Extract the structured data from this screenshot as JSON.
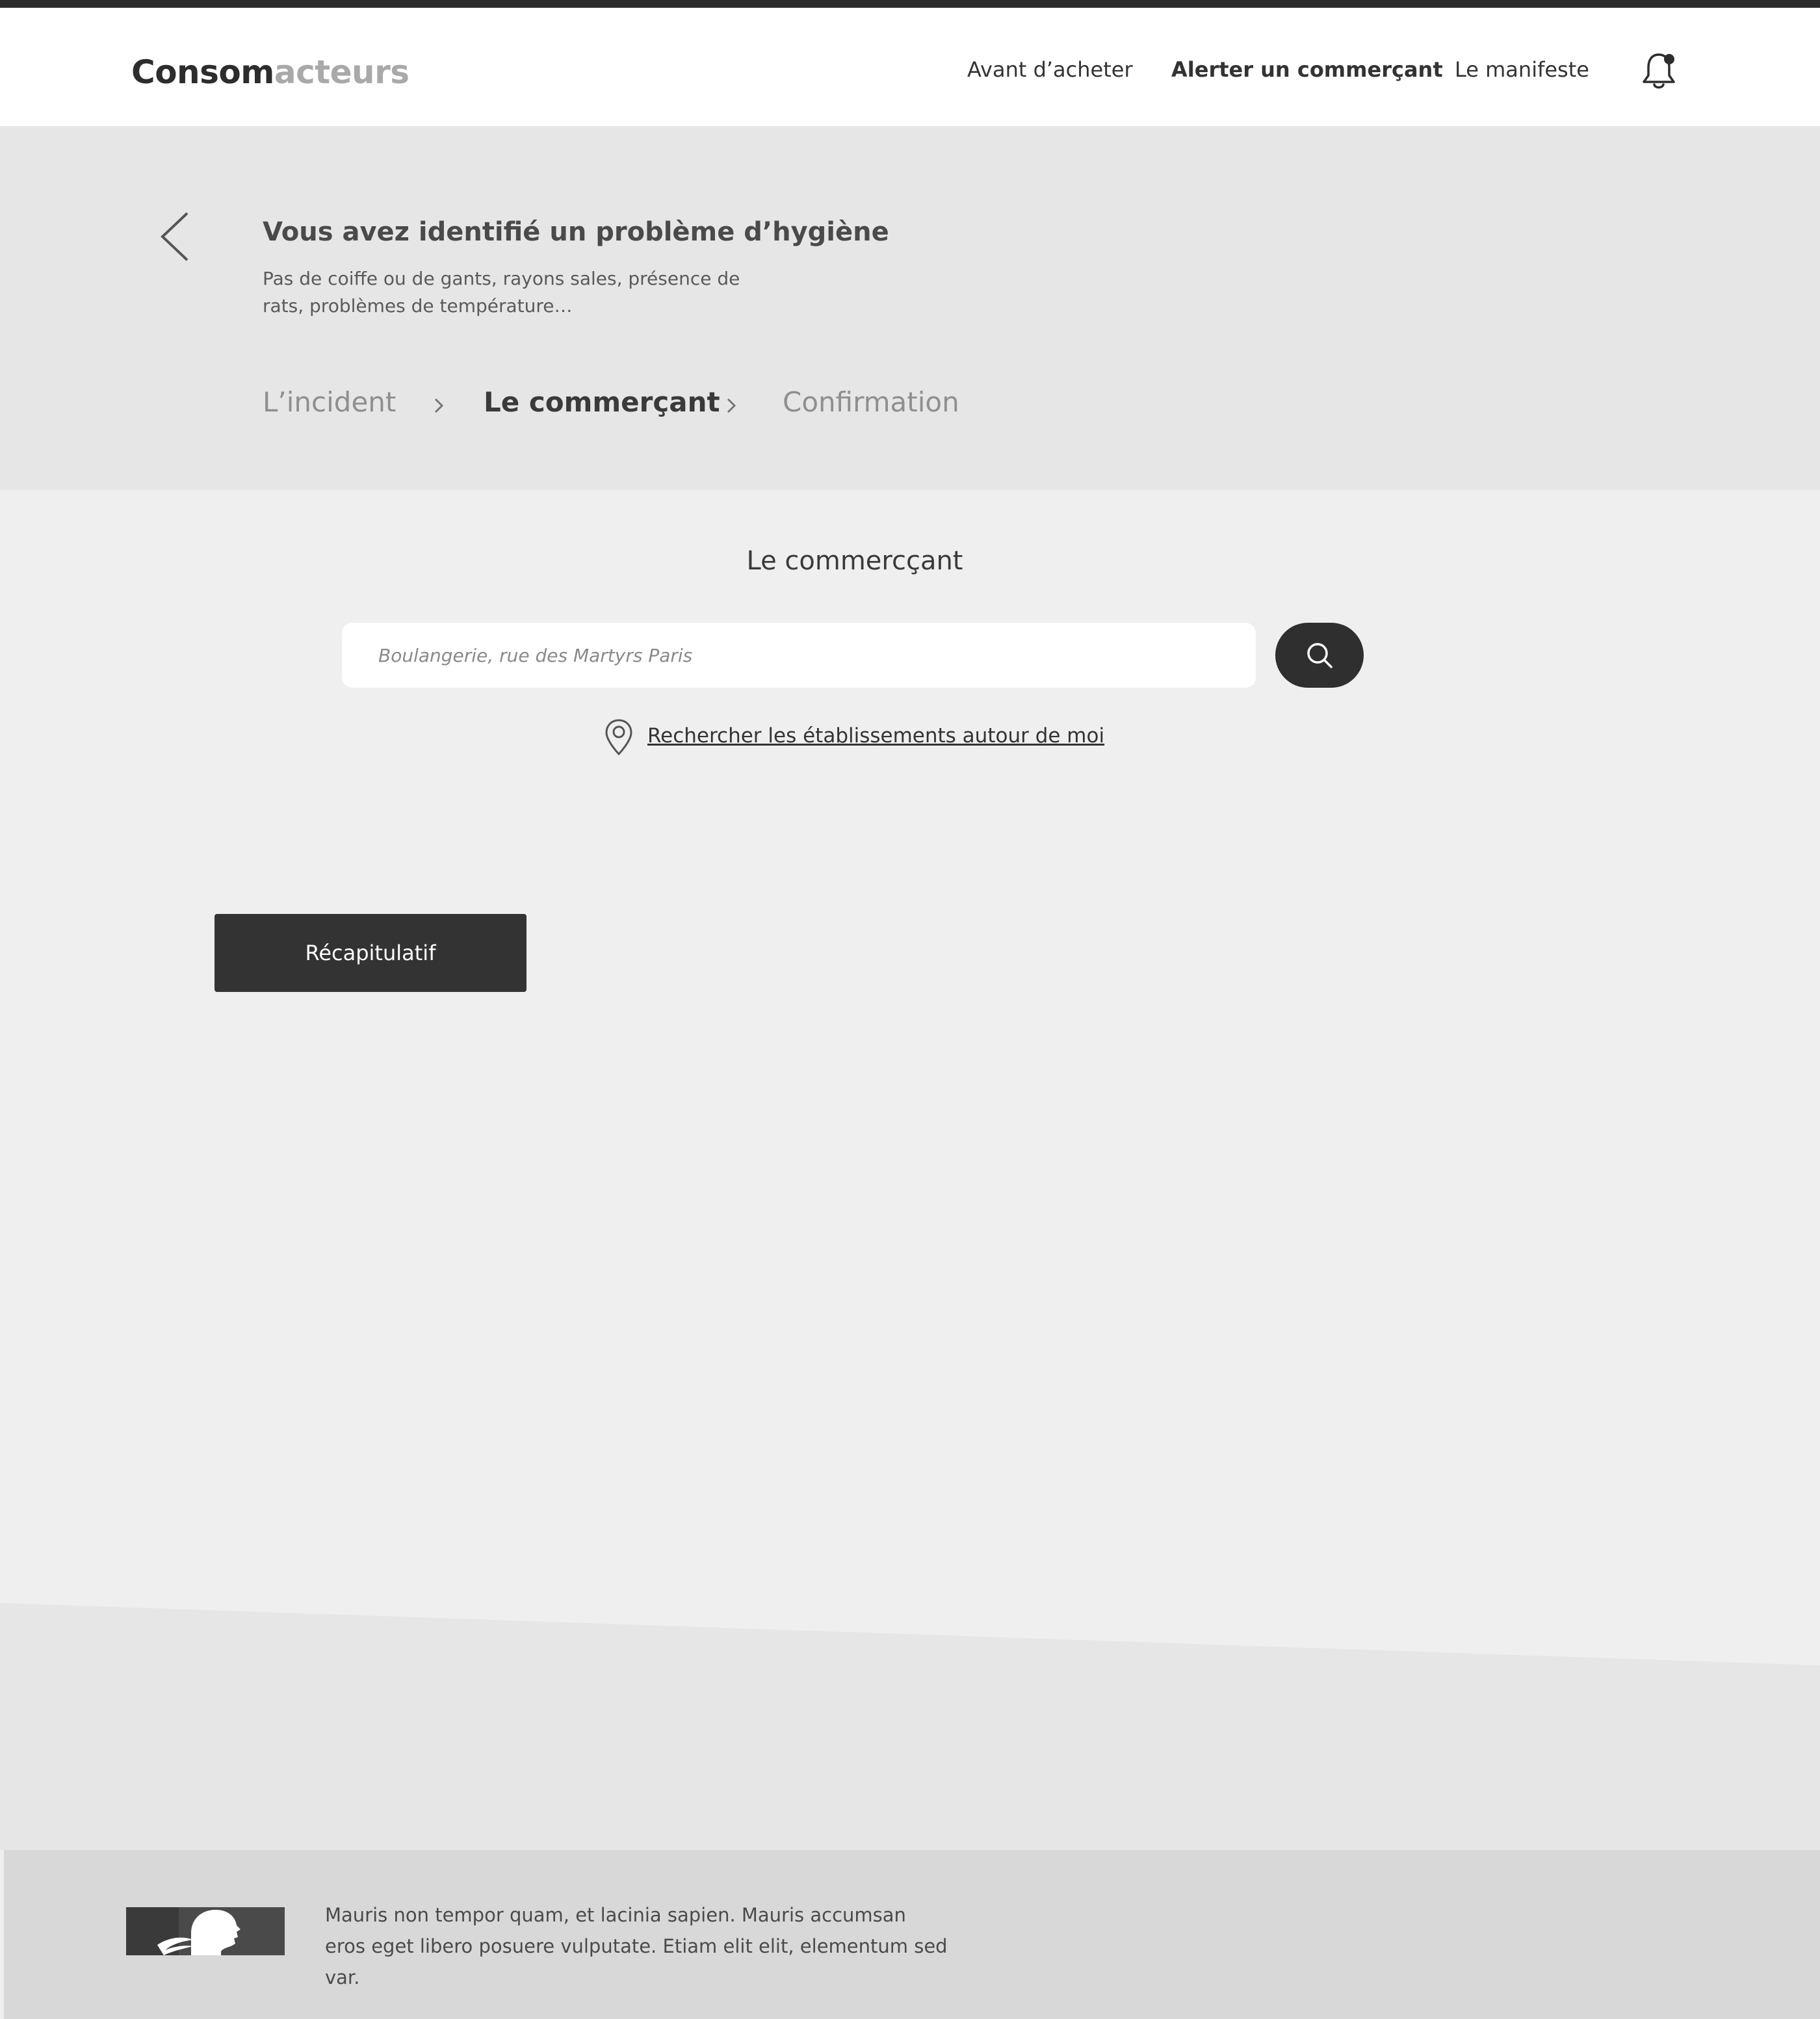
{
  "header": {
    "logo_part1": "Consom",
    "logo_part2": "acteurs",
    "nav": [
      "Avant d’acheter",
      "Alerter un commerçant",
      "Le manifeste"
    ]
  },
  "hero": {
    "title": "Vous avez identifié un problème d’hygiène",
    "subtitle": "Pas de coiffe ou de gants, rayons sales, présence de rats, problèmes de température…",
    "steps": [
      "L’incident",
      "Le commerçant",
      "Confirmation"
    ],
    "active_step": 1
  },
  "main": {
    "section_title": "Le commercçant",
    "search_placeholder": "Boulangerie, rue des Martyrs Paris",
    "geo_link": "Rechercher les établissements autour de moi",
    "recap_label": "Récapitulatif"
  },
  "footer": {
    "text": "Mauris non tempor quam, et lacinia sapien. Mauris accumsan eros eget libero posuere vulputate. Etiam elit elit, elementum sed var."
  },
  "colors": {
    "dark": "#2d2d2d",
    "accent_gray": "#a9a9a9",
    "hero_bg": "#e6e6e6",
    "main_bg": "#efefef",
    "footer_bg": "#d8d8d8"
  },
  "icons": [
    "bell-icon",
    "back-arrow-icon",
    "chevron-right-icon",
    "search-icon",
    "map-pin-icon",
    "marianne-logo"
  ]
}
